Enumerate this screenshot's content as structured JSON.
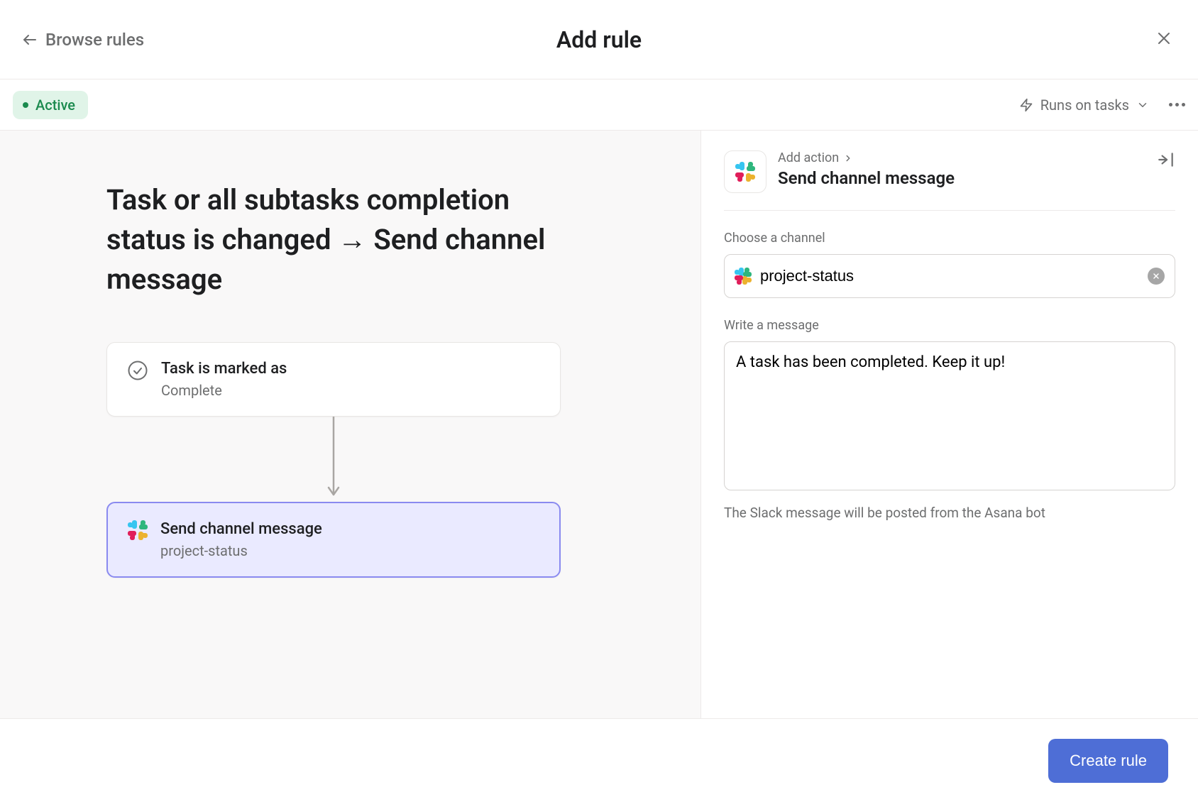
{
  "header": {
    "back_label": "Browse rules",
    "title": "Add rule"
  },
  "toolbar": {
    "status": "Active",
    "runs_on": "Runs on tasks"
  },
  "rule": {
    "title": "Task or all subtasks completion status is changed → Send channel message"
  },
  "trigger_card": {
    "title": "Task is marked as",
    "sub": "Complete"
  },
  "action_card": {
    "title": "Send channel message",
    "sub": "project-status"
  },
  "right_pane": {
    "breadcrumb": "Add action",
    "action_title": "Send channel message",
    "choose_channel_label": "Choose a channel",
    "channel_value": "project-status",
    "write_message_label": "Write a message",
    "message_value": "A task has been completed. Keep it up!",
    "hint": "The Slack message will be posted from the Asana bot"
  },
  "footer": {
    "create_label": "Create rule"
  }
}
